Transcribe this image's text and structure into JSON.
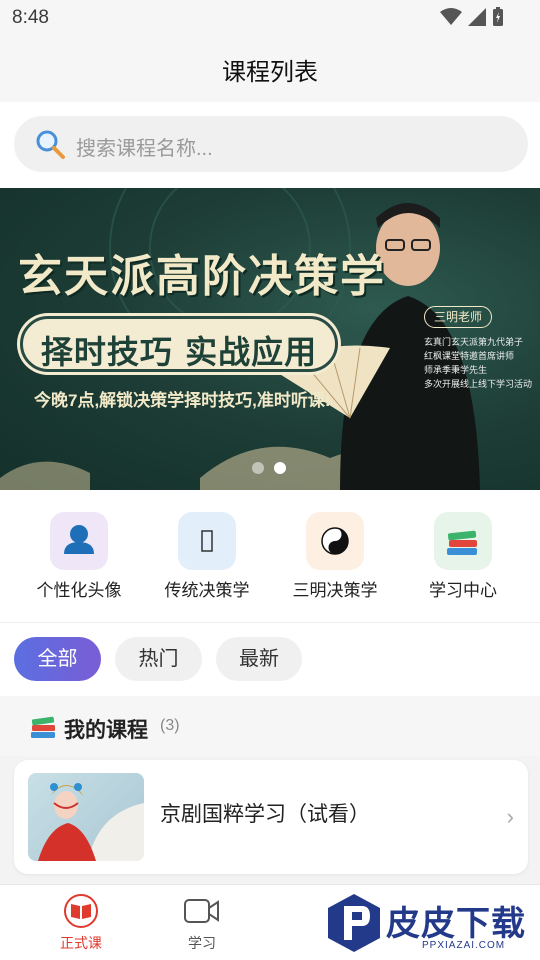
{
  "status_bar": {
    "time": "8:48"
  },
  "header": {
    "title": "课程列表"
  },
  "search": {
    "placeholder": "搜索课程名称..."
  },
  "banner": {
    "headline": "玄天派高阶决策学",
    "pill": "择时技巧 实战应用",
    "subtitle": "今晚7点,解锁决策学择时技巧,准时听课!",
    "teacher_tag": "三明老师",
    "bio": [
      "玄真门玄天派第九代弟子",
      "红枫课堂特邀首席讲师",
      "师承季秉学先生",
      "多次开展线上线下学习活动"
    ],
    "slide_count": 2,
    "active_slide": 2
  },
  "shortcuts": [
    {
      "label": "个性化头像",
      "icon": "user-icon"
    },
    {
      "label": "传统决策学",
      "icon": "bagua-icon"
    },
    {
      "label": "三明决策学",
      "icon": "yin-yang-icon"
    },
    {
      "label": "学习中心",
      "icon": "books-icon"
    }
  ],
  "tabs": [
    {
      "label": "全部",
      "active": true
    },
    {
      "label": "热门",
      "active": false
    },
    {
      "label": "最新",
      "active": false
    }
  ],
  "my_courses": {
    "title": "我的课程",
    "count": "(3)",
    "items": [
      {
        "title": "京剧国粹学习（试看）"
      }
    ]
  },
  "bottom_nav": [
    {
      "label": "正式课",
      "icon": "book-icon",
      "active": true
    },
    {
      "label": "学习",
      "icon": "video-icon",
      "active": false
    }
  ],
  "watermark": {
    "text": "皮皮下载",
    "sub": "PPXIAZAI.COM"
  },
  "colors": {
    "accent": "#6a66dc",
    "nav_active": "#e03a2f",
    "banner_bg": "#1d3d36"
  }
}
